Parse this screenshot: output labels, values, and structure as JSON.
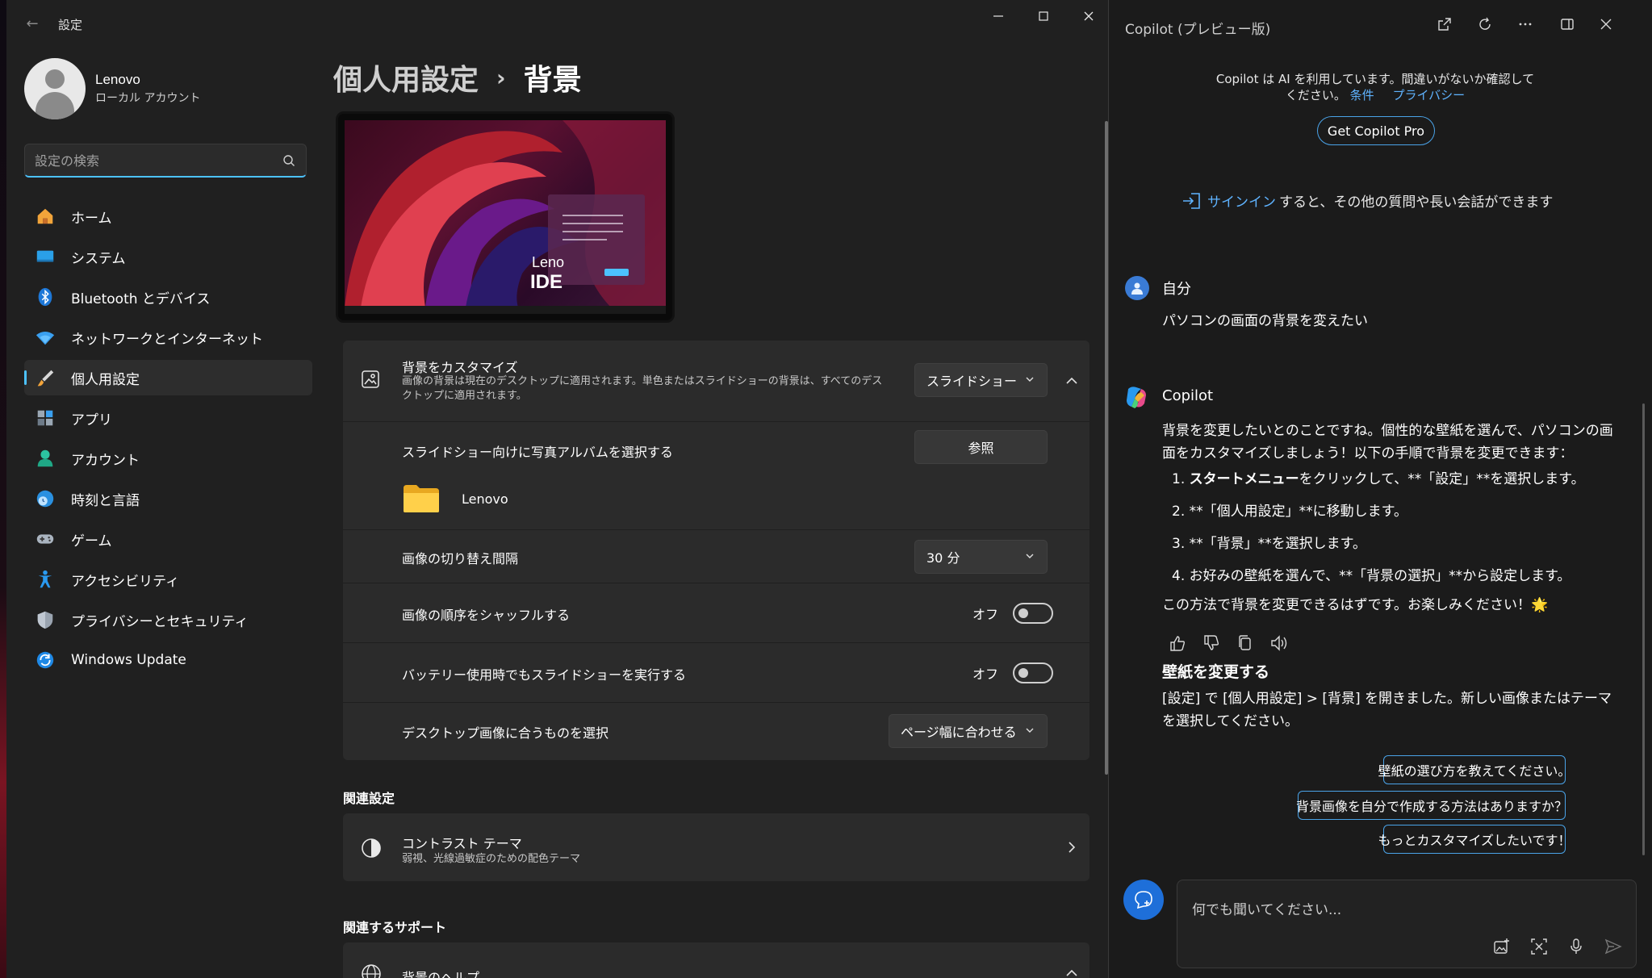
{
  "settings": {
    "title": "設定",
    "profile": {
      "name": "Lenovo",
      "sub": "ローカル アカウント"
    },
    "search": {
      "placeholder": "設定の検索"
    },
    "nav": [
      {
        "label": "ホーム",
        "icon": "home-icon"
      },
      {
        "label": "システム",
        "icon": "system-icon"
      },
      {
        "label": "Bluetooth とデバイス",
        "icon": "bluetooth-icon"
      },
      {
        "label": "ネットワークとインターネット",
        "icon": "wifi-icon"
      },
      {
        "label": "個人用設定",
        "icon": "brush-icon",
        "active": true
      },
      {
        "label": "アプリ",
        "icon": "apps-icon"
      },
      {
        "label": "アカウント",
        "icon": "account-icon"
      },
      {
        "label": "時刻と言語",
        "icon": "globe-clock-icon"
      },
      {
        "label": "ゲーム",
        "icon": "gamepad-icon"
      },
      {
        "label": "アクセシビリティ",
        "icon": "accessibility-icon"
      },
      {
        "label": "プライバシーとセキュリティ",
        "icon": "shield-icon"
      },
      {
        "label": "Windows Update",
        "icon": "update-icon"
      }
    ],
    "breadcrumb": {
      "parent": "個人用設定",
      "separator": "›",
      "current": "背景"
    },
    "preview": {
      "brand_text_1": "Leno",
      "brand_text_2": "IDE"
    },
    "background": {
      "title": "背景をカスタマイズ",
      "desc": "画像の背景は現在のデスクトップに適用されます。単色またはスライドショーの背景は、すべてのデスクトップに適用されます。",
      "value": "スライドショー"
    },
    "album": {
      "label": "スライドショー向けに写真アルバムを選択する",
      "button": "参照",
      "folder": "Lenovo"
    },
    "interval": {
      "label": "画像の切り替え間隔",
      "value": "30 分"
    },
    "shuffle": {
      "label": "画像の順序をシャッフルする",
      "state": "オフ"
    },
    "battery": {
      "label": "バッテリー使用時でもスライドショーを実行する",
      "state": "オフ"
    },
    "fit": {
      "label": "デスクトップ画像に合うものを選択",
      "value": "ページ幅に合わせる"
    },
    "related_settings": {
      "heading": "関連設定",
      "contrast_title": "コントラスト テーマ",
      "contrast_desc": "弱視、光線過敏症のための配色テーマ"
    },
    "related_support": {
      "heading": "関連するサポート",
      "help_title": "背景のヘルプ"
    }
  },
  "copilot": {
    "title": "Copilot (プレビュー版)",
    "notice_line1": "Copilot は AI を利用しています。間違いがないか確認して",
    "notice_line2": "ください。",
    "terms": "条件",
    "privacy": "プライバシー",
    "pro_button": "Get Copilot Pro",
    "signin_link": "サインイン",
    "signin_rest": "すると、その他の質問や長い会話ができます",
    "user_name": "自分",
    "user_message": "パソコンの画面の背景を変えたい",
    "bot_name": "Copilot",
    "reply_intro": "背景を変更したいとのことですね。個性的な壁紙を選んで、パソコンの画面をカスタマイズしましょう！以下の手順で背景を変更できます：",
    "steps": [
      {
        "num": "1.",
        "bold": "スタートメニュー",
        "rest": "をクリックして、**「設定」**を選択します。"
      },
      {
        "num": "2.",
        "bold": "",
        "rest": "**「個人用設定」**に移動します。"
      },
      {
        "num": "3.",
        "bold": "",
        "rest": "**「背景」**を選択します。"
      },
      {
        "num": "4.",
        "bold": "",
        "rest": "お好みの壁紙を選んで、**「背景の選択」**から設定します。"
      }
    ],
    "reply_outro": "この方法で背景を変更できるはずです。お楽しみください！🌟",
    "card_heading": "壁紙を変更する",
    "card_text": "[設定] で [個人用設定] > [背景] を開きました。新しい画像またはテーマを選択してください。",
    "suggestions": [
      "壁紙の選び方を教えてください。",
      "背景画像を自分で作成する方法はありますか？",
      "もっとカスタマイズしたいです！"
    ],
    "input_placeholder": "何でも聞いてください..."
  },
  "colors": {
    "accent": "#4cc2ff",
    "link": "#5fb3ff",
    "chip_border": "#4aa3e8"
  }
}
